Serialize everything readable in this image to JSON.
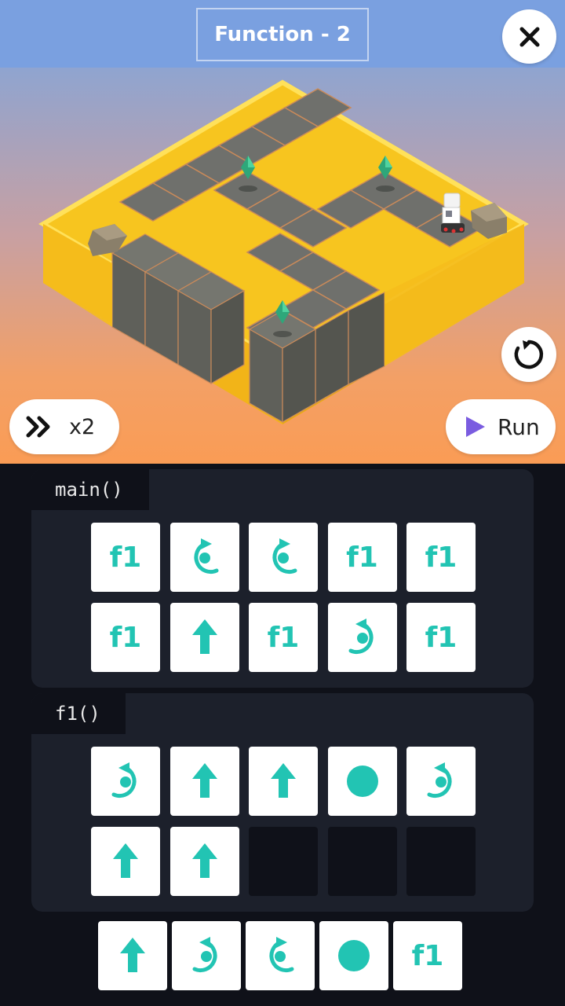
{
  "header": {
    "level_title": "Function - 2"
  },
  "controls": {
    "speed_label": "x2",
    "run_label": "Run"
  },
  "colors": {
    "accent_teal": "#22c4b3",
    "run_triangle": "#7a5ce0",
    "lava": "#f9c623",
    "stone": "#6f706c"
  },
  "main": {
    "label": "main()",
    "slots": [
      "f1",
      "turn-right",
      "turn-right",
      "f1",
      "f1",
      "f1",
      "forward",
      "f1",
      "turn-left",
      "f1"
    ]
  },
  "f1": {
    "label": "f1()",
    "slots": [
      "turn-left",
      "forward",
      "forward",
      "light",
      "turn-left",
      "forward",
      "forward",
      "",
      "",
      ""
    ]
  },
  "palette": {
    "commands": [
      "forward",
      "turn-left",
      "turn-right",
      "light",
      "f1"
    ]
  },
  "command_labels": {
    "f1": "f1"
  }
}
